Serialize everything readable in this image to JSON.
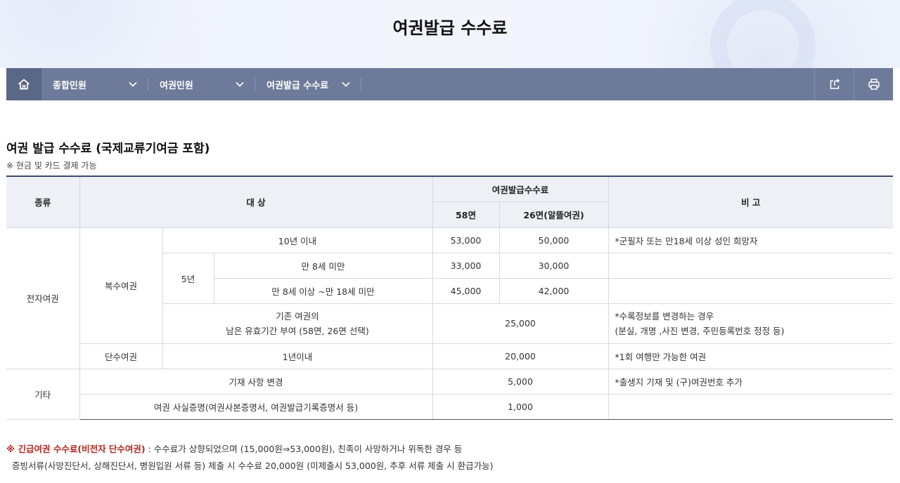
{
  "page_title": "여권발급 수수료",
  "nav": {
    "items": [
      {
        "label": "종합민원"
      },
      {
        "label": "여권민원"
      },
      {
        "label": "여권발급 수수료"
      }
    ]
  },
  "section": {
    "title": "여권 발급 수수료 (국제교류기여금 포함)",
    "note": "※ 현금 및 카드 결제 가능"
  },
  "table": {
    "headers": {
      "type": "종류",
      "target": "대 상",
      "fee": "여권발급수수료",
      "fee58": "58면",
      "fee26": "26면(알뜰여권)",
      "remark": "비 고"
    },
    "rows": {
      "cat_electronic": "전자여권",
      "cat_other": "기타",
      "multi_passport": "복수여권",
      "single_passport": "단수여권",
      "r1_target": "10년 이내",
      "r1_fee58": "53,000",
      "r1_fee26": "50,000",
      "r1_remark": "*군필자 또는 만18세 이상 성인 희망자",
      "five_year": "5년",
      "r2_target": "만 8세 미만",
      "r2_fee58": "33,000",
      "r2_fee26": "30,000",
      "r3_target": "만 8세 이상 ~만 18세 미만",
      "r3_fee58": "45,000",
      "r3_fee26": "42,000",
      "r4_target_line1": "기존 여권의",
      "r4_target_line2": "남은 유효기간 부여 (58면, 26면 선택)",
      "r4_fee": "25,000",
      "r4_remark_line1": "*수록정보를 변경하는 경우",
      "r4_remark_line2": "(분실, 개명 ,사진 변경, 주민등록번호 정정 등)",
      "r5_target": "1년이내",
      "r5_fee": "20,000",
      "r5_remark": "*1회 여행만 가능한 여권",
      "r6_target": "기재 사항 변경",
      "r6_fee": "5,000",
      "r6_remark": "*출생지 기재 및 (구)여권번호 추가",
      "r7_target": "여권 사실증명(여권사본증명서, 여권발급기록증명서 등)",
      "r7_fee": "1,000"
    }
  },
  "footer": {
    "emphasis": "※ 긴급여권 수수료(비전자 단수여권)",
    "line1_rest": " : 수수료가 상향되었으며 (15,000원⇒53,000원), 친족이 사망하거나 위독한 경우 등",
    "line2": "증빙서류(사망진단서, 상해진단서, 병원입원 서류 등) 제출 시 수수료 20,000원 (미제출시 53,000원, 추후 서류 제출 시 환급가능)"
  },
  "icons": {
    "home": "home-icon",
    "chevron": "chevron-down-icon",
    "share": "share-icon",
    "print": "print-icon"
  },
  "colors": {
    "nav_bg": "#6d7a99",
    "nav_home_bg": "#5b6786",
    "table_header_bg": "#eef0f5",
    "emphasis_red": "#b3261e"
  }
}
